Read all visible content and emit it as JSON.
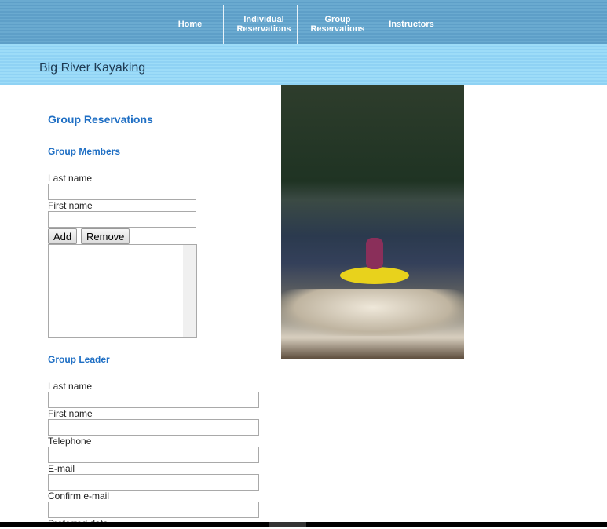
{
  "nav": {
    "items": [
      {
        "label": "Home"
      },
      {
        "label": "Individual Reservations"
      },
      {
        "label": "Group Reservations"
      },
      {
        "label": "Instructors"
      }
    ]
  },
  "site_title": "Big River Kayaking",
  "page_title": "Group Reservations",
  "members": {
    "heading": "Group Members",
    "last_name": "Last name",
    "first_name": "First name",
    "add": "Add",
    "remove": "Remove"
  },
  "leader": {
    "heading": "Group Leader",
    "last_name": "Last name",
    "first_name": "First name",
    "telephone": "Telephone",
    "email": "E-mail",
    "confirm_email": "Confirm e-mail",
    "preferred_date": "Preferred date"
  },
  "colors": {
    "nav": "#6aaad0",
    "banner": "#9ddcf8",
    "heading": "#1f6fc4"
  }
}
